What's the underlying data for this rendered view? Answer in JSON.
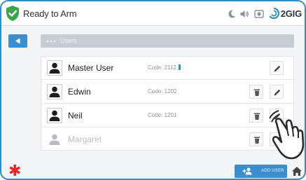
{
  "header": {
    "status": "Ready to Arm",
    "brand": "2GIG",
    "icons": [
      "shield-check-icon",
      "moon-icon",
      "speaker-icon",
      "camera-icon",
      "brand-logo"
    ]
  },
  "breadcrumb": {
    "label": "Users"
  },
  "users": [
    {
      "name": "Master User",
      "code": "Code: 2112",
      "deletable": false,
      "enabled": true
    },
    {
      "name": "Edwin",
      "code": "Code: 1202",
      "deletable": true,
      "enabled": true
    },
    {
      "name": "Neil",
      "code": "Code: 1201",
      "deletable": true,
      "enabled": true
    },
    {
      "name": "Margaret",
      "code": "",
      "deletable": true,
      "enabled": false
    }
  ],
  "footer": {
    "add_user_label": "ADD USER",
    "emergency_icon": "asterisk-icon",
    "home_icon": "home-icon"
  },
  "colors": {
    "accent": "#3a8fd1",
    "status_ok": "#3aa84a",
    "emergency": "#e8232a"
  }
}
